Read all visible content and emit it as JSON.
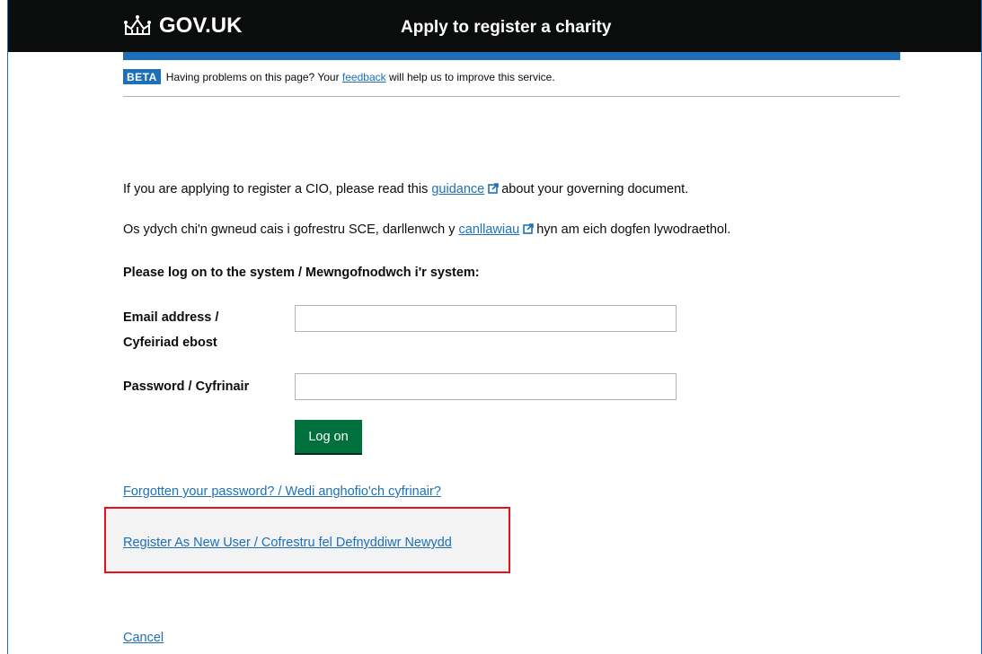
{
  "header": {
    "logo_text": "GOV.UK",
    "service_name": "Apply to register a charity"
  },
  "phase_banner": {
    "tag": "BETA",
    "text_before": "Having problems on this page? Your ",
    "link": "feedback",
    "text_after": " will help us to improve this service."
  },
  "content": {
    "para1_before": "If you are applying to register a CIO, please read this ",
    "para1_link": "guidance",
    "para1_after": "about your governing document.",
    "para2_before": "Os ydych chi'n gwneud cais i gofrestru SCE, darllenwch y ",
    "para2_link": "canllawiau",
    "para2_after": "hyn am eich dogfen lywodraethol.",
    "login_heading": "Please log on to the system / Mewngofnodwch i'r system:"
  },
  "form": {
    "email_label_line1": "Email address /",
    "email_label_line2": "Cyfeiriad ebost",
    "email_value": "",
    "password_label": "Password / Cyfrinair",
    "password_value": "",
    "submit_label": "Log on"
  },
  "links": {
    "forgot": "Forgotten your password? / Wedi anghofio'ch cyfrinair?",
    "register": "Register As New User / Cofrestru fel Defnyddiwr Newydd",
    "cancel": "Cancel"
  },
  "colors": {
    "header_bg": "#0b0c0c",
    "accent_blue": "#1d70b8",
    "button_green": "#00703c",
    "highlight_border": "#e8111b"
  },
  "icons": {
    "logo": "crown-icon",
    "external": "external-link-icon"
  }
}
